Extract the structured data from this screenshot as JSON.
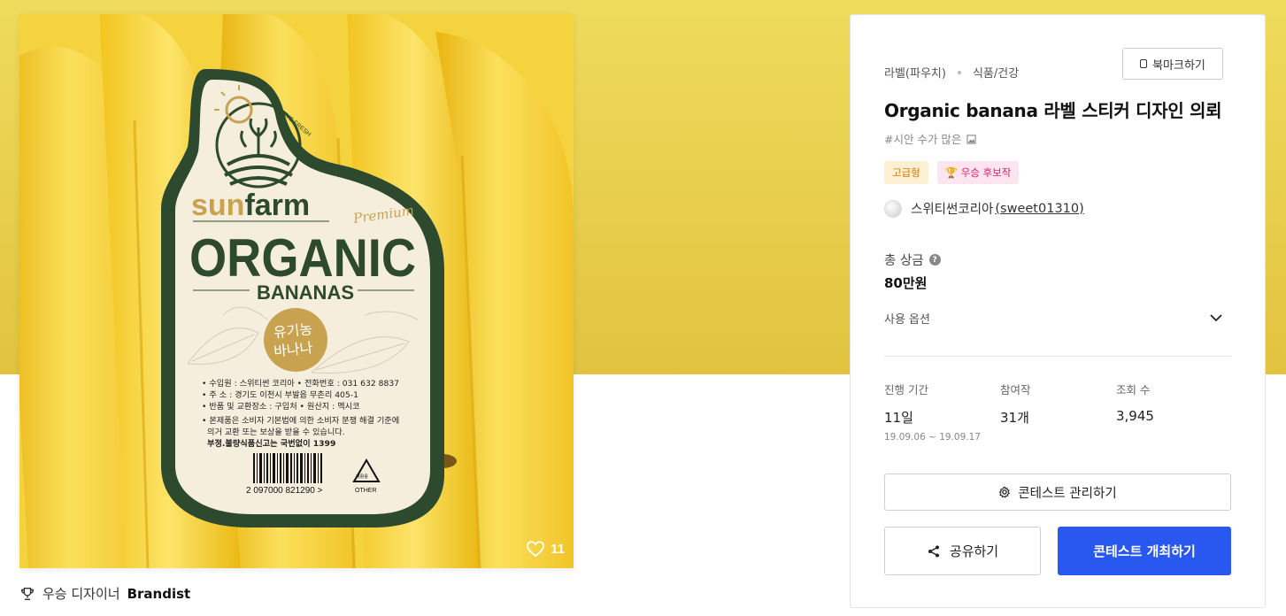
{
  "colors": {
    "hero_bg": "#e9d24f",
    "primary_button": "#2858f0",
    "badge_premium_text": "#d3790c",
    "badge_candidate_text": "#d8226d"
  },
  "image": {
    "label_text": {
      "tagline": "ALWAYS FRESH",
      "brand_sun": "sun",
      "brand_farm": "farm",
      "premium": "Premium",
      "organic": "ORGANIC",
      "bananas": "BANANAS",
      "korean_script_1": "유기농",
      "korean_script_2": "바나나",
      "info_line_1": "• 수입원 : 스위티썬 코리아  • 전화번호 : 031 632 8837",
      "info_line_2": "• 주    소 : 경기도 이천시 부발읍 무촌리 405-1",
      "info_line_3": "• 반품 및 교환장소 : 구입처  • 원산지 : 멕시코",
      "info_line_4": "• 본제품은 소비자 기본법에 의한 소비자 분쟁 해결 기준에",
      "info_line_5": "의거 교환 또는 보상을 받을 수 있습니다.",
      "info_line_6": "부정.불량식품신고는 국번없이 1399",
      "barcode_number": "2 097000 821290 >",
      "recycle_label": "OTHER",
      "recycle_mark": "재활용"
    },
    "likes": "11"
  },
  "winner": {
    "prefix": "우승 디자이너",
    "name": "Brandist",
    "icon": "trophy-icon"
  },
  "panel": {
    "breadcrumb": [
      "라벨(파우치)",
      "식품/건강"
    ],
    "bookmark_label": "북마크하기",
    "title": "Organic banana 라벨 스티커 디자인 의뢰",
    "hashtag": "#시안 수가 많은",
    "badges": {
      "premium": "고급형",
      "candidate": "🏆 우승 후보작"
    },
    "designer": {
      "name": "스위티썬코리아",
      "id": "(sweet01310)"
    },
    "prize": {
      "label": "총 상금",
      "value": "80만원"
    },
    "options_label": "사용 옵션",
    "stats": {
      "period": {
        "label": "진행 기간",
        "value": "11일",
        "range": "19.09.06 ~ 19.09.17"
      },
      "entries": {
        "label": "참여작",
        "value": "31개"
      },
      "views": {
        "label": "조회 수",
        "value": "3,945"
      }
    },
    "manage_label": "콘테스트 관리하기",
    "share_label": "공유하기",
    "host_label": "콘테스트 개최하기"
  }
}
